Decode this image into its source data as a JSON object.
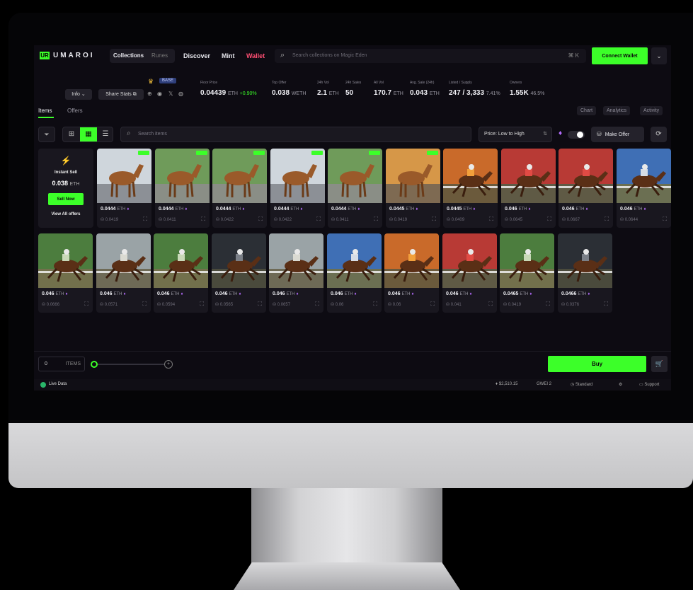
{
  "app": {
    "logo_mark": "UR",
    "logo_text": "UMAROI",
    "nav": {
      "collections": "Collections",
      "runes": "Runes",
      "discover": "Discover",
      "mint": "Mint",
      "wallet": "Wallet"
    },
    "search_placeholder": "Search collections on Magic Eden",
    "search_shortcut": "⌘ K",
    "connect_wallet": "Connect Wallet"
  },
  "collection": {
    "chain_badge": "BASE",
    "info_label": "Info",
    "share_label": "Share Stats",
    "stats": [
      {
        "label": "Floor Price",
        "value": "0.04439",
        "unit": "ETH",
        "change": "+0.90%"
      },
      {
        "label": "Top Offer",
        "value": "0.038",
        "unit": "WETH"
      },
      {
        "label": "24h Vol",
        "value": "2.1",
        "unit": "ETH"
      },
      {
        "label": "24h Sales",
        "value": "50",
        "unit": ""
      },
      {
        "label": "All Vol",
        "value": "170.7",
        "unit": "ETH"
      },
      {
        "label": "Avg. Sale (24h)",
        "value": "0.043",
        "unit": "ETH"
      },
      {
        "label": "Listed / Supply",
        "value": "247 / 3,333",
        "unit": "7.41%"
      },
      {
        "label": "Owners",
        "value": "1.55K",
        "unit": "46.5%"
      }
    ]
  },
  "tabs": {
    "items": "Items",
    "offers": "Offers",
    "chart": "Chart",
    "analytics": "Analytics",
    "activity": "Activity"
  },
  "toolbar": {
    "search_placeholder": "Search items",
    "sort": "Price: Low to High",
    "make_offer": "Make Offer"
  },
  "instant_sell": {
    "title": "Instant Sell",
    "value": "0.038",
    "unit": "ETH",
    "sell_now": "Sell Now",
    "view_all": "View All offers"
  },
  "colors": {
    "accent": "#3cff29",
    "wallet": "#ff4f73",
    "gem": "#b56cff"
  },
  "cards": [
    {
      "price": "0.0444",
      "offer": "0.0419",
      "listed": true,
      "scene": "standing-grey"
    },
    {
      "price": "0.0444",
      "offer": "0.0411",
      "listed": true,
      "scene": "standing-green"
    },
    {
      "price": "0.0444",
      "offer": "0.0422",
      "listed": true,
      "scene": "standing-green"
    },
    {
      "price": "0.0444",
      "offer": "0.0422",
      "listed": true,
      "scene": "standing-grey"
    },
    {
      "price": "0.0444",
      "offer": "0.0411",
      "listed": true,
      "scene": "standing-green"
    },
    {
      "price": "0.0445",
      "offer": "0.0419",
      "listed": true,
      "scene": "standing-orange"
    },
    {
      "price": "0.0445",
      "offer": "0.0409",
      "listed": false,
      "scene": "race-orange"
    },
    {
      "price": "0.046",
      "offer": "0.0645",
      "listed": false,
      "scene": "race-red"
    },
    {
      "price": "0.046",
      "offer": "0.0667",
      "listed": false,
      "scene": "race-red"
    },
    {
      "price": "0.046",
      "offer": "0.0644",
      "listed": false,
      "scene": "race-blue"
    },
    {
      "price": "0.046",
      "offer": "0.0666",
      "listed": false,
      "scene": "race-green"
    },
    {
      "price": "0.046",
      "offer": "0.0571",
      "listed": false,
      "scene": "race-grey"
    },
    {
      "price": "0.046",
      "offer": "0.0594",
      "listed": false,
      "scene": "race-green"
    },
    {
      "price": "0.046",
      "offer": "0.0565",
      "listed": false,
      "scene": "race-dark"
    },
    {
      "price": "0.046",
      "offer": "0.0657",
      "listed": false,
      "scene": "race-grey"
    },
    {
      "price": "0.046",
      "offer": "0.06",
      "listed": false,
      "scene": "race-blue"
    },
    {
      "price": "0.046",
      "offer": "0.06",
      "listed": false,
      "scene": "race-orange"
    },
    {
      "price": "0.046",
      "offer": "0.041",
      "listed": false,
      "scene": "race-red"
    },
    {
      "price": "0.0465",
      "offer": "0.0419",
      "listed": false,
      "scene": "race-green"
    },
    {
      "price": "0.0466",
      "offer": "0.0376",
      "listed": false,
      "scene": "race-dark"
    }
  ],
  "card_unit": "ETH",
  "bottom": {
    "qty": "0",
    "items_label": "ITEMS",
    "buy": "Buy",
    "slider_level": 0
  },
  "status": {
    "live": "Live Data",
    "eth_price": "$2,510.15",
    "gwei": "GWEI 2",
    "mode": "Standard",
    "support": "Support"
  }
}
